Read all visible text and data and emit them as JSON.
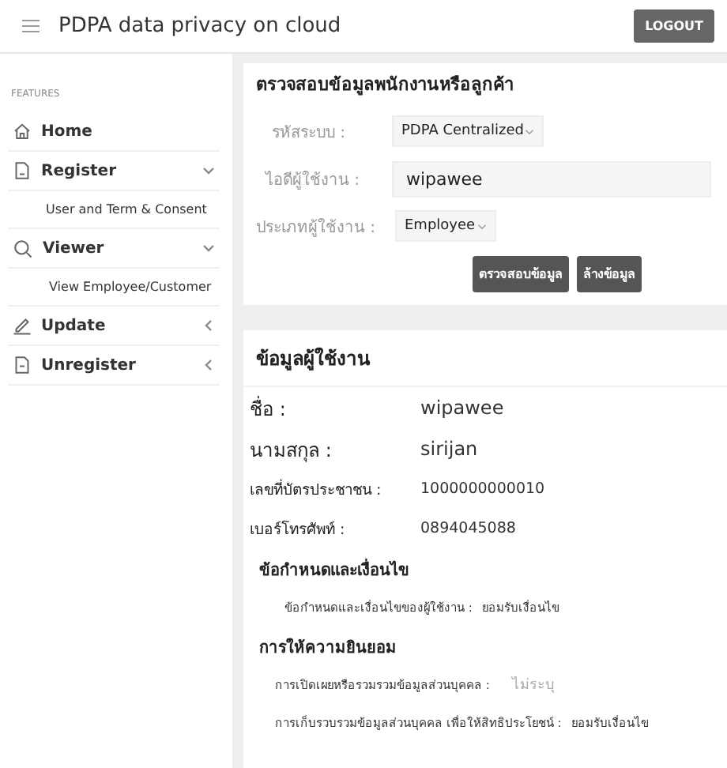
{
  "header": {
    "title": "PDPA data privacy on cloud",
    "logout": "LOGOUT"
  },
  "sidebar": {
    "section_label": "FEATURES",
    "items": [
      {
        "label": "Home",
        "kind": "link"
      },
      {
        "label": "Register",
        "kind": "group",
        "expanded": true,
        "children": [
          {
            "label": "User and Term & Consent"
          }
        ]
      },
      {
        "label": "Viewer",
        "kind": "group",
        "expanded": true,
        "children": [
          {
            "label": "View Employee/Customer"
          }
        ]
      },
      {
        "label": "Update",
        "kind": "group",
        "expanded": false
      },
      {
        "label": "Unregister",
        "kind": "group",
        "expanded": false
      }
    ]
  },
  "check_card": {
    "title": "ตรวจสอบข้อมูลพนักงานหรือลูกค้า",
    "fields": [
      {
        "label": "รหัสระบบ :",
        "kind": "select",
        "value": "PDPA Centralized"
      },
      {
        "label": "ไอดีผู้ใช้งาน :",
        "kind": "input",
        "value": "wipawee"
      },
      {
        "label": "ประเภทผู้ใช้งาน :",
        "kind": "select",
        "value": "Employee"
      }
    ],
    "buttons": [
      "ตรวจสอบข้อมูล",
      "ล้างข้อมูล"
    ]
  },
  "user_card": {
    "title": "ข้อมูลผู้ใช้งาน",
    "rows": [
      {
        "label": "ชื่อ :",
        "value": "wipawee",
        "kind": "large"
      },
      {
        "label": "นามสกุล :",
        "value": "sirijan",
        "kind": "large"
      },
      {
        "label": "เลขที่บัตรประชาชน :",
        "value": "1000000000010",
        "kind": "normal"
      },
      {
        "label": "เบอร์โทรศัพท์ :",
        "value": "0894045088",
        "kind": "normal"
      }
    ],
    "sections": [
      {
        "title": "ข้อกำหนดและเงื่อนไข",
        "rows": [
          {
            "label": "ข้อกำหนดและเงื่อนไขของผู้ใช้งาน :",
            "value": "ยอมรับเงื่อนไข",
            "muted": false
          }
        ]
      },
      {
        "title": "การให้ความยินยอม",
        "rows": [
          {
            "label": "การเปิดเผยหรือรวมรวมข้อมูลส่วนบุคคล :",
            "value": "ไม่ระบุ",
            "muted": true
          },
          {
            "label": "การเก็บรวบรวมข้อมูลส่วนบุคคล เพื่อให้สิทธิประโยชน์ :",
            "value": "ยอมรับเงื่อนไข",
            "muted": false
          }
        ]
      }
    ]
  }
}
